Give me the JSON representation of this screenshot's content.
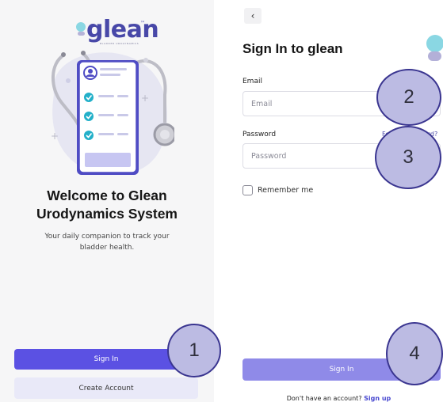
{
  "left_screen": {
    "logo": {
      "wordmark": "glean",
      "trademark": "™",
      "tagline": "BLADDER UROGYNAMICS"
    },
    "welcome_title_line1": "Welcome to Glean",
    "welcome_title_line2": "Urodynamics System",
    "welcome_subtitle": "Your daily companion to track your bladder health.",
    "sign_in_label": "Sign In",
    "create_account_label": "Create Account"
  },
  "right_screen": {
    "back_label": "‹",
    "title": "Sign In to glean",
    "email": {
      "label": "Email",
      "placeholder": "Email",
      "value": ""
    },
    "password": {
      "label": "Password",
      "placeholder": "Password",
      "value": ""
    },
    "forgot_label": "Forgot password?",
    "remember_label": "Remember me",
    "remember_checked": false,
    "sign_in_label": "Sign In",
    "signup_prompt": "Don't have an account?",
    "signup_link": "Sign up"
  },
  "markers": [
    "1",
    "2",
    "3",
    "4"
  ],
  "colors": {
    "primary": "#5b51e3",
    "primary_disabled": "#8f8ae8",
    "secondary_bg": "#e9e9f8",
    "brand_text": "#4848a8",
    "brand_teal": "#8ad7e3",
    "marker_fill": "#bcbbe3",
    "marker_border": "#3a3590"
  }
}
